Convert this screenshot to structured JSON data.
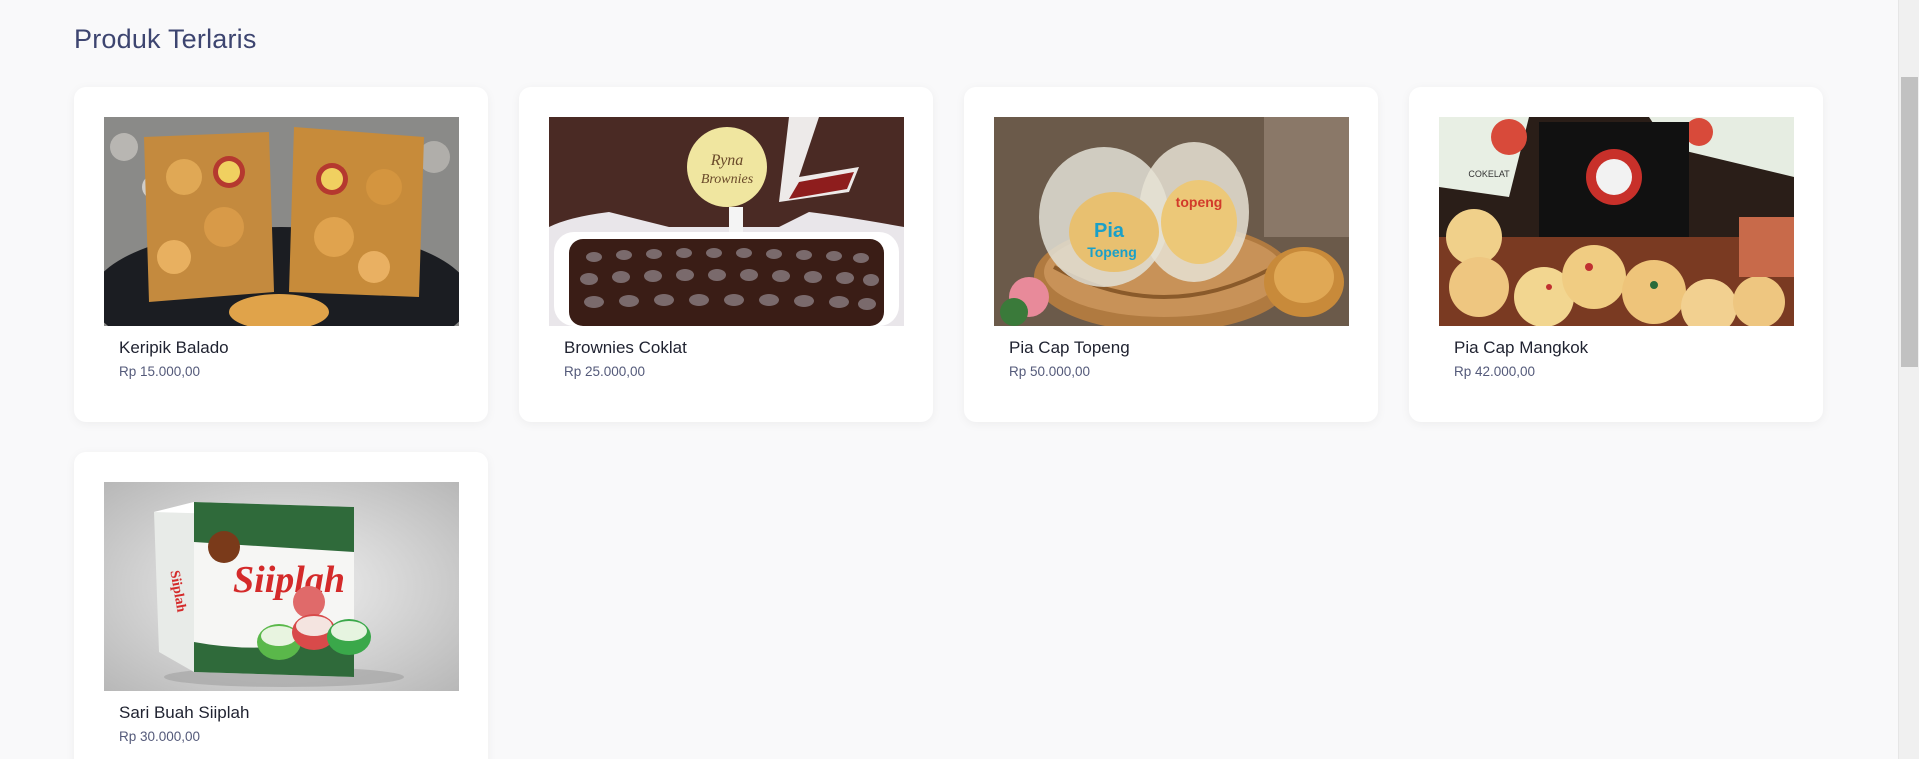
{
  "section": {
    "title": "Produk Terlaris"
  },
  "products": [
    {
      "name": "Keripik Balado",
      "price": "Rp 15.000,00",
      "image_icon": "chips-product-photo"
    },
    {
      "name": "Brownies Coklat",
      "price": "Rp 25.000,00",
      "image_icon": "brownies-product-photo",
      "image_text": "Ryna Brownies"
    },
    {
      "name": "Pia Cap Topeng",
      "price": "Rp 50.000,00",
      "image_icon": "pia-basket-product-photo",
      "image_text": "Pia Cap Topeng"
    },
    {
      "name": "Pia Cap Mangkok",
      "price": "Rp 42.000,00",
      "image_icon": "pia-mangkok-product-photo",
      "image_text": "COKELAT"
    },
    {
      "name": "Sari Buah Siiplah",
      "price": "Rp 30.000,00",
      "image_icon": "juice-box-product-photo",
      "image_text": "Siiplah"
    }
  ],
  "colors": {
    "background": "#f9f9fa",
    "card": "#ffffff",
    "title": "#3d4570",
    "product_name": "#1f2230",
    "price": "#545a7a"
  }
}
